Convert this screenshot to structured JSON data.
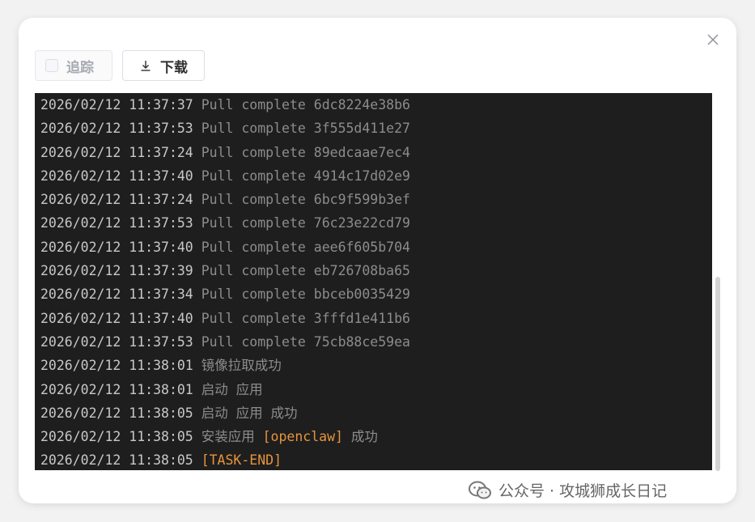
{
  "toolbar": {
    "trace_label": "追踪",
    "download_label": "下载"
  },
  "console": {
    "lines": [
      {
        "time": "2026/02/12 11:37:37",
        "message": "Pull complete 6dc8224e38b6",
        "accent": ""
      },
      {
        "time": "2026/02/12 11:37:53",
        "message": "Pull complete 3f555d411e27",
        "accent": ""
      },
      {
        "time": "2026/02/12 11:37:24",
        "message": "Pull complete 89edcaae7ec4",
        "accent": ""
      },
      {
        "time": "2026/02/12 11:37:40",
        "message": "Pull complete 4914c17d02e9",
        "accent": ""
      },
      {
        "time": "2026/02/12 11:37:24",
        "message": "Pull complete 6bc9f599b3ef",
        "accent": ""
      },
      {
        "time": "2026/02/12 11:37:53",
        "message": "Pull complete 76c23e22cd79",
        "accent": ""
      },
      {
        "time": "2026/02/12 11:37:40",
        "message": "Pull complete aee6f605b704",
        "accent": ""
      },
      {
        "time": "2026/02/12 11:37:39",
        "message": "Pull complete eb726708ba65",
        "accent": ""
      },
      {
        "time": "2026/02/12 11:37:34",
        "message": "Pull complete bbceb0035429",
        "accent": ""
      },
      {
        "time": "2026/02/12 11:37:40",
        "message": "Pull complete 3fffd1e411b6",
        "accent": ""
      },
      {
        "time": "2026/02/12 11:37:53",
        "message": "Pull complete 75cb88ce59ea",
        "accent": ""
      },
      {
        "time": "2026/02/12 11:38:01",
        "message": "镜像拉取成功",
        "accent": ""
      },
      {
        "time": "2026/02/12 11:38:01",
        "message": "启动 应用",
        "accent": ""
      },
      {
        "time": "2026/02/12 11:38:05",
        "message": "启动 应用 成功",
        "accent": ""
      },
      {
        "time": "2026/02/12 11:38:05",
        "message": "安装应用",
        "accent": "[openclaw]",
        "suffix": "成功"
      },
      {
        "time": "2026/02/12 11:38:05",
        "message": "",
        "accent": "[TASK-END]"
      }
    ]
  },
  "watermark": {
    "text": "公众号 · 攻城狮成长日记"
  },
  "colors": {
    "console_bg": "#1e1e1e",
    "accent": "#e6943c"
  }
}
